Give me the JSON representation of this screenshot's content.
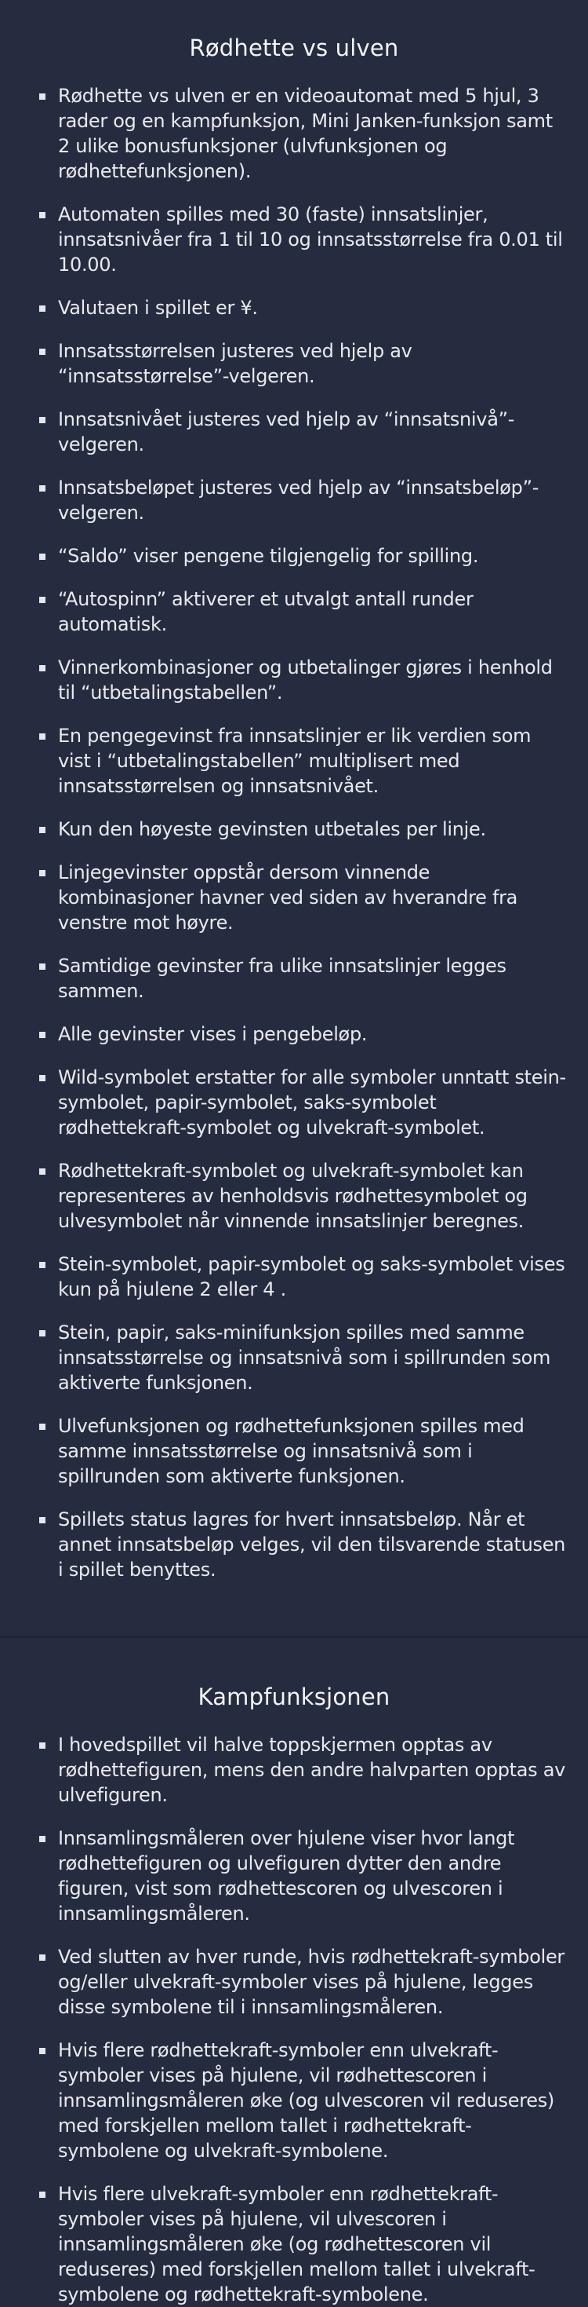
{
  "sections": [
    {
      "title": "Rødhette vs ulven",
      "items": [
        "Rødhette vs ulven er en videoautomat med 5 hjul, 3 rader og en kampfunksjon, Mini Janken-funksjon samt 2 ulike bonusfunksjoner (ulvfunksjonen og rødhettefunksjonen).",
        "Automaten spilles med 30 (faste) innsatslinjer, innsatsnivåer fra 1 til 10 og innsatsstørrelse fra 0.01 til 10.00.",
        "Valutaen i spillet er ¥.",
        "Innsatsstørrelsen justeres ved hjelp av “innsatsstørrelse”-velgeren.",
        "Innsatsnivået justeres ved hjelp av “innsatsnivå”-velgeren.",
        "Innsatsbeløpet justeres ved hjelp av “innsatsbeløp”-velgeren.",
        "“Saldo” viser pengene tilgjengelig for spilling.",
        "“Autospinn” aktiverer et utvalgt antall runder automatisk.",
        "Vinnerkombinasjoner og utbetalinger gjøres i henhold til “utbetalingstabellen”.",
        "En pengegevinst fra innsatslinjer er lik verdien som vist i “utbetalingstabellen” multiplisert med innsatsstørrelsen og innsatsnivået.",
        "Kun den høyeste gevinsten utbetales per linje.",
        "Linjegevinster oppstår dersom vinnende kombinasjoner havner ved siden av hverandre fra venstre mot høyre.",
        "Samtidige gevinster fra ulike innsatslinjer legges sammen.",
        "Alle gevinster vises i pengebeløp.",
        "Wild-symbolet erstatter for alle symboler unntatt stein-symbolet, papir-symbolet, saks-symbolet rødhettekraft-symbolet og ulvekraft-symbolet.",
        "Rødhettekraft-symbolet og ulvekraft-symbolet kan representeres av henholdsvis rødhettesymbolet og ulvesymbolet når vinnende innsatslinjer beregnes.",
        "Stein-symbolet, papir-symbolet og saks-symbolet vises kun på hjulene 2 eller 4 .",
        "Stein, papir, saks-minifunksjon spilles med samme innsatsstørrelse og innsatsnivå som i spillrunden som aktiverte funksjonen.",
        "Ulvefunksjonen og rødhettefunksjonen spilles med samme innsatsstørrelse og innsatsnivå som i spillrunden som aktiverte funksjonen.",
        "Spillets status lagres for hvert innsatsbeløp. Når et annet innsatsbeløp velges, vil den tilsvarende statusen i spillet benyttes."
      ]
    },
    {
      "title": "Kampfunksjonen",
      "items": [
        "I hovedspillet vil halve toppskjermen opptas av rødhettefiguren, mens den andre halvparten opptas av ulvefiguren.",
        "Innsamlingsmåleren over hjulene viser hvor langt rødhettefiguren og ulvefiguren dytter den andre figuren, vist som rødhettescoren og ulvescoren i innsamlingsmåleren.",
        "Ved slutten av hver runde, hvis rødhettekraft-symboler og/eller ulvekraft-symboler vises på hjulene, legges disse symbolene til i innsamlingsmåleren.",
        "Hvis flere rødhettekraft-symboler enn ulvekraft-symboler vises på hjulene, vil rødhettescoren i innsamlingsmåleren øke (og ulvescoren vil reduseres) med forskjellen mellom tallet i rødhettekraft-symbolene og ulvekraft-symbolene.",
        "Hvis flere ulvekraft-symboler enn rødhettekraft-symboler vises på hjulene, vil ulvescoren i innsamlingsmåleren øke (og rødhettescoren vil reduseres) med forskjellen mellom tallet i ulvekraft-symbolene og rødhettekraft-symbolene."
      ]
    }
  ]
}
